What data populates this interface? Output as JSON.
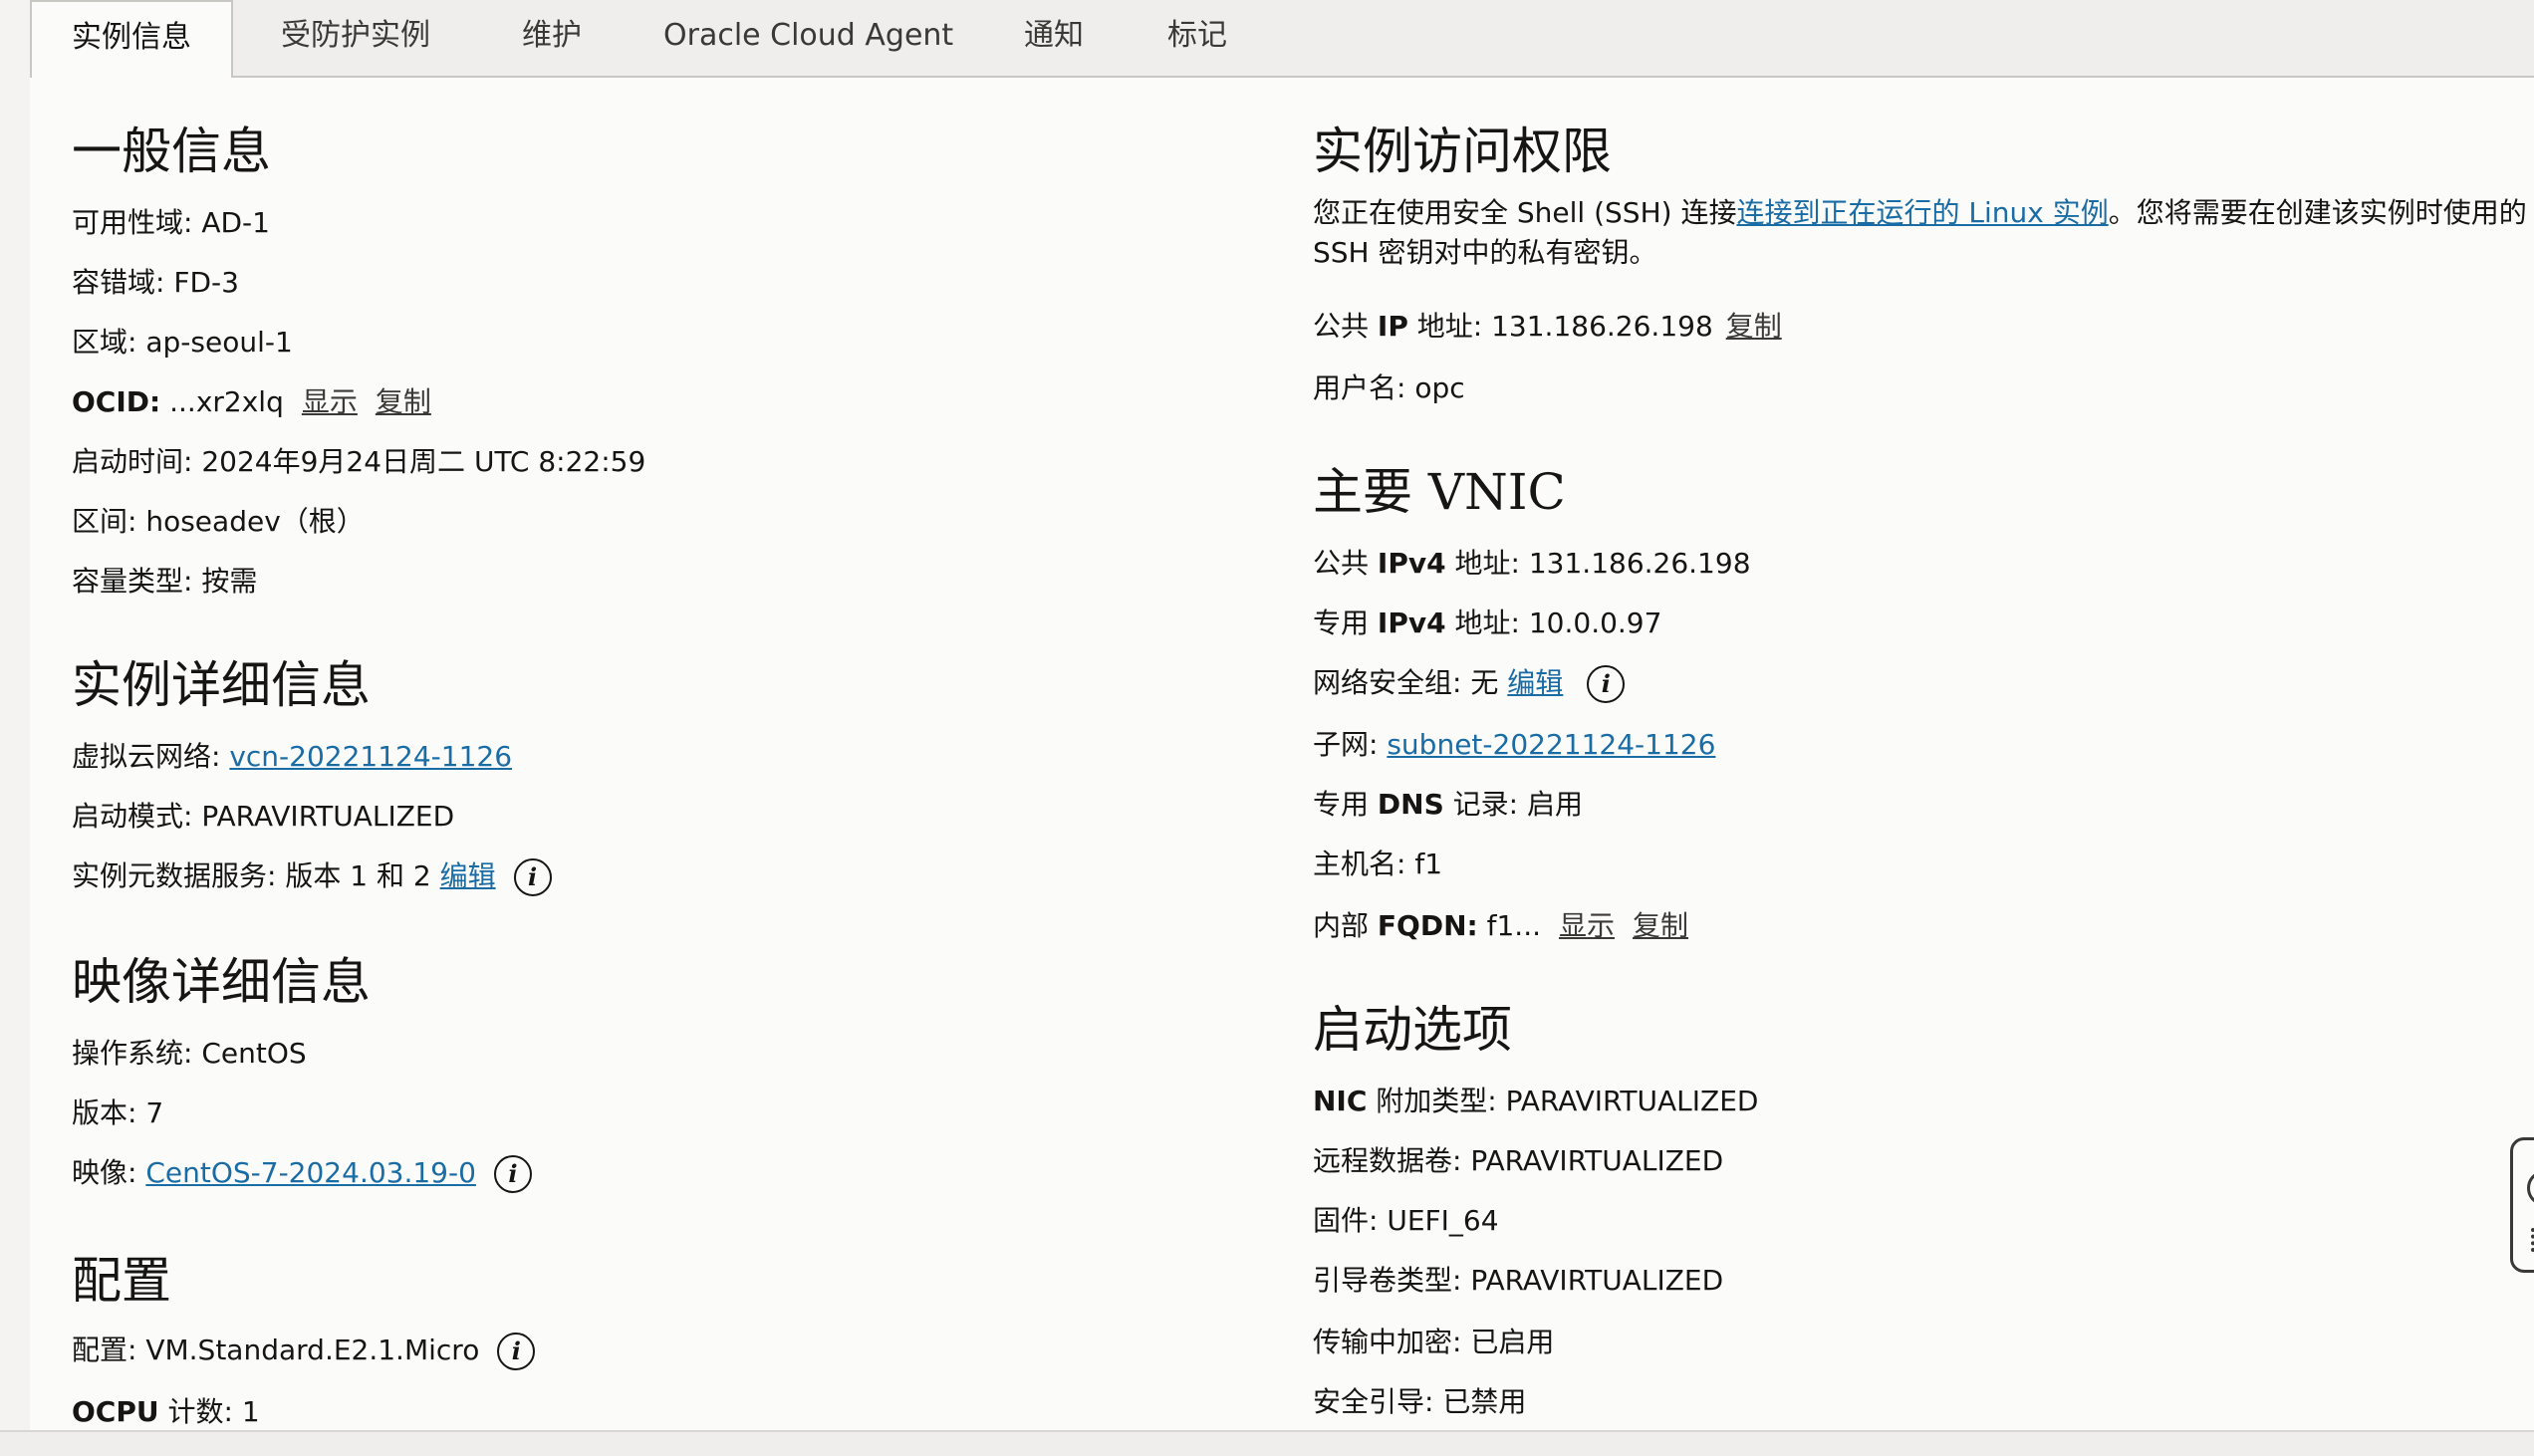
{
  "tabs": [
    {
      "label": "实例信息",
      "active": true
    },
    {
      "label": "受防护实例"
    },
    {
      "label": "维护"
    },
    {
      "label": "Oracle Cloud Agent"
    },
    {
      "label": "通知"
    },
    {
      "label": "标记"
    }
  ],
  "general": {
    "title": "一般信息",
    "ad_label": "可用性域:",
    "ad_value": "AD-1",
    "fd_label": "容错域:",
    "fd_value": "FD-3",
    "region_label": "区域:",
    "region_value": "ap-seoul-1",
    "ocid_label": "OCID:",
    "ocid_value": "...xr2xlq",
    "ocid_show": "显示",
    "ocid_copy": "复制",
    "launch_label": "启动时间:",
    "launch_value": "2024年9月24日周二 UTC 8:22:59",
    "compartment_label": "区间:",
    "compartment_value": "hoseadev（根）",
    "capacity_label": "容量类型:",
    "capacity_value": "按需"
  },
  "instance_details": {
    "title": "实例详细信息",
    "vcn_label": "虚拟云网络:",
    "vcn_value": "vcn-20221124-1126",
    "launch_mode_label": "启动模式:",
    "launch_mode_value": "PARAVIRTUALIZED",
    "imds_label": "实例元数据服务:",
    "imds_value": "版本 1 和 2",
    "imds_edit": "编辑"
  },
  "image_details": {
    "title": "映像详细信息",
    "os_label": "操作系统:",
    "os_value": "CentOS",
    "version_label": "版本:",
    "version_value": "7",
    "image_label": "映像:",
    "image_value": "CentOS-7-2024.03.19-0"
  },
  "config": {
    "title": "配置",
    "shape_label": "配置:",
    "shape_value": "VM.Standard.E2.1.Micro",
    "ocpu_label_b": "OCPU",
    "ocpu_label": " 计数:",
    "ocpu_value": "1"
  },
  "access": {
    "title": "实例访问权限",
    "desc_before": "您正在使用安全 Shell (SSH) 连接",
    "desc_link": "连接到正在运行的 Linux 实例",
    "desc_after": "。您将需要在创建该实例时使用的 SSH 密钥对中的私有密钥。",
    "public_ip_label_a": "公共 ",
    "public_ip_label_b": "IP",
    "public_ip_label_c": " 地址:",
    "public_ip_value": "131.186.26.198",
    "public_ip_copy": "复制",
    "username_label": "用户名:",
    "username_value": "opc"
  },
  "vnic": {
    "title": "主要 VNIC",
    "pub_ipv4_a": "公共 ",
    "pub_ipv4_b": "IPv4",
    "pub_ipv4_c": " 地址:",
    "pub_ipv4_value": "131.186.26.198",
    "priv_ipv4_a": "专用 ",
    "priv_ipv4_b": "IPv4",
    "priv_ipv4_c": " 地址:",
    "priv_ipv4_value": "10.0.0.97",
    "nsg_label": "网络安全组:",
    "nsg_value": "无",
    "nsg_edit": "编辑",
    "subnet_label": "子网:",
    "subnet_value": "subnet-20221124-1126",
    "dns_a": "专用 ",
    "dns_b": "DNS",
    "dns_c": " 记录:",
    "dns_value": "启用",
    "hostname_label": "主机名:",
    "hostname_value": "f1",
    "fqdn_a": "内部 ",
    "fqdn_b": "FQDN:",
    "fqdn_value": "f1...",
    "fqdn_show": "显示",
    "fqdn_copy": "复制"
  },
  "launch_options": {
    "title": "启动选项",
    "nic_b": "NIC",
    "nic_c": " 附加类型:",
    "nic_value": "PARAVIRTUALIZED",
    "remote_label": "远程数据卷:",
    "remote_value": "PARAVIRTUALIZED",
    "firmware_label": "固件:",
    "firmware_value": "UEFI_64",
    "boot_label": "引导卷类型:",
    "boot_value": "PARAVIRTUALIZED",
    "transit_label": "传输中加密:",
    "transit_value": "已启用",
    "secure_boot_label": "安全引导:",
    "secure_boot_value": "已禁用"
  }
}
